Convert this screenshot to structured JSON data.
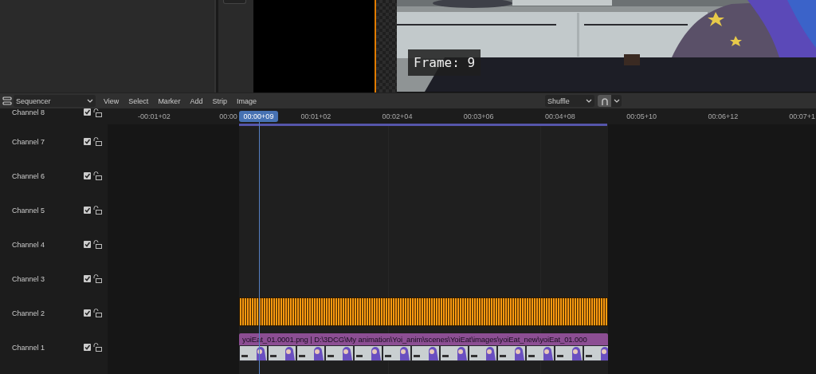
{
  "viewer": {
    "overlay": "Frame: 9"
  },
  "header": {
    "editor": "Sequencer",
    "menus": [
      "View",
      "Select",
      "Marker",
      "Add",
      "Strip",
      "Image"
    ],
    "overlap_mode": "Shuffle",
    "snapping": true
  },
  "ruler": {
    "ticks": [
      "-00:01+02",
      "00:00",
      "00:01+02",
      "00:02+04",
      "00:03+06",
      "00:04+08",
      "00:05+10",
      "00:06+12",
      "00:07+1"
    ],
    "playhead": "00:00+09"
  },
  "channels": [
    {
      "name": "Channel 8",
      "visible": true,
      "locked": false
    },
    {
      "name": "Channel 7",
      "visible": true,
      "locked": false
    },
    {
      "name": "Channel 6",
      "visible": true,
      "locked": false
    },
    {
      "name": "Channel 5",
      "visible": true,
      "locked": false
    },
    {
      "name": "Channel 4",
      "visible": true,
      "locked": false
    },
    {
      "name": "Channel 3",
      "visible": true,
      "locked": false
    },
    {
      "name": "Channel 2",
      "visible": true,
      "locked": false,
      "strip": {
        "kind": "sound"
      }
    },
    {
      "name": "Channel 1",
      "visible": true,
      "locked": false,
      "strip": {
        "label": "yoiEat_01.0001.png | D:\\3DCG\\My animation\\Yoi_anim\\scenes\\YoiEat\\images\\yoiEat_new\\yoiEat_01.000"
      }
    }
  ]
}
